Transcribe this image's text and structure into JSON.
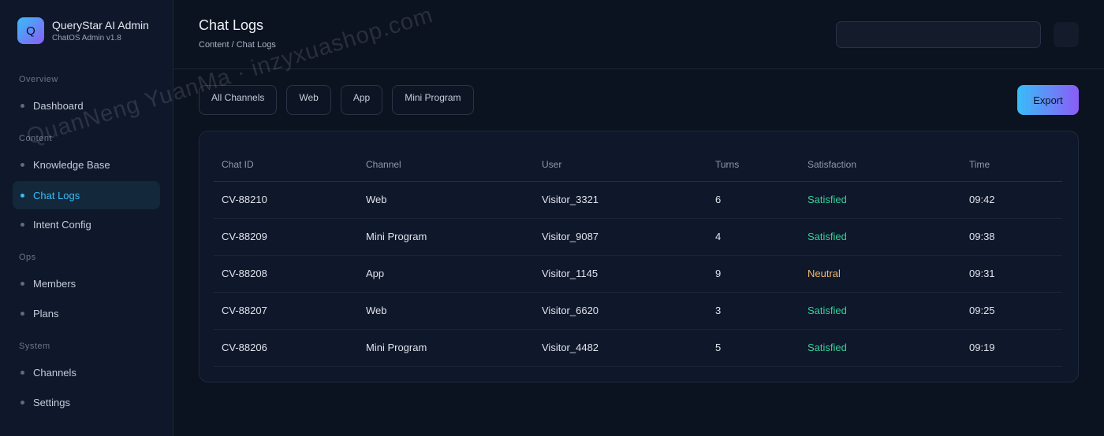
{
  "brand": {
    "logo_letter": "Q",
    "title": "QueryStar AI Admin",
    "subtitle": "ChatOS Admin v1.8"
  },
  "sidebar": {
    "sections": [
      {
        "title": "Overview",
        "items": [
          {
            "label": "Dashboard",
            "active": false
          }
        ]
      },
      {
        "title": "Content",
        "items": [
          {
            "label": "Knowledge Base",
            "active": false
          },
          {
            "label": "Chat Logs",
            "active": true
          },
          {
            "label": "Intent Config",
            "active": false
          }
        ]
      },
      {
        "title": "Ops",
        "items": [
          {
            "label": "Members",
            "active": false
          },
          {
            "label": "Plans",
            "active": false
          }
        ]
      },
      {
        "title": "System",
        "items": [
          {
            "label": "Channels",
            "active": false
          },
          {
            "label": "Settings",
            "active": false
          }
        ]
      }
    ]
  },
  "header": {
    "title": "Chat Logs",
    "breadcrumb": "Content / Chat Logs",
    "search_value": ""
  },
  "filters": {
    "chips": [
      "All Channels",
      "Web",
      "App",
      "Mini Program"
    ],
    "export_label": "Export"
  },
  "table": {
    "headers": [
      "Chat ID",
      "Channel",
      "User",
      "Turns",
      "Satisfaction",
      "Time"
    ],
    "rows": [
      [
        "CV-88210",
        "Web",
        "Visitor_3321",
        "6",
        "Satisfied",
        "09:42"
      ],
      [
        "CV-88209",
        "Mini Program",
        "Visitor_9087",
        "4",
        "Satisfied",
        "09:38"
      ],
      [
        "CV-88208",
        "App",
        "Visitor_1145",
        "9",
        "Neutral",
        "09:31"
      ],
      [
        "CV-88207",
        "Web",
        "Visitor_6620",
        "3",
        "Satisfied",
        "09:25"
      ],
      [
        "CV-88206",
        "Mini Program",
        "Visitor_4482",
        "5",
        "Satisfied",
        "09:19"
      ]
    ]
  },
  "colors": {
    "accent": "#38bdf8",
    "accent2": "#8b5cf6",
    "satisfied": "#34d399",
    "neutral": "#f0b86e"
  },
  "watermark": "QuanNeng YuanMa · inzyxuashop.com"
}
